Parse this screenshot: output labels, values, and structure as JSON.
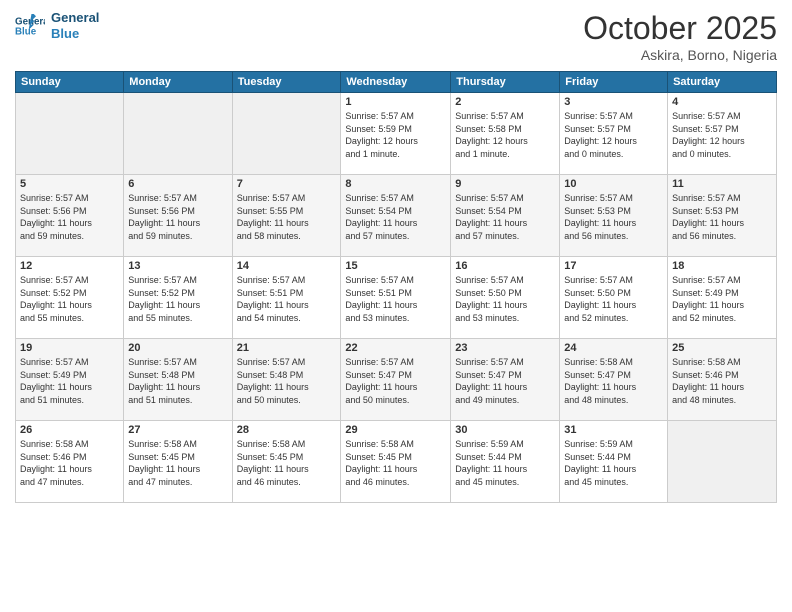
{
  "logo": {
    "line1": "General",
    "line2": "Blue"
  },
  "title": "October 2025",
  "location": "Askira, Borno, Nigeria",
  "days_of_week": [
    "Sunday",
    "Monday",
    "Tuesday",
    "Wednesday",
    "Thursday",
    "Friday",
    "Saturday"
  ],
  "weeks": [
    [
      {
        "day": "",
        "info": ""
      },
      {
        "day": "",
        "info": ""
      },
      {
        "day": "",
        "info": ""
      },
      {
        "day": "1",
        "info": "Sunrise: 5:57 AM\nSunset: 5:59 PM\nDaylight: 12 hours\nand 1 minute."
      },
      {
        "day": "2",
        "info": "Sunrise: 5:57 AM\nSunset: 5:58 PM\nDaylight: 12 hours\nand 1 minute."
      },
      {
        "day": "3",
        "info": "Sunrise: 5:57 AM\nSunset: 5:57 PM\nDaylight: 12 hours\nand 0 minutes."
      },
      {
        "day": "4",
        "info": "Sunrise: 5:57 AM\nSunset: 5:57 PM\nDaylight: 12 hours\nand 0 minutes."
      }
    ],
    [
      {
        "day": "5",
        "info": "Sunrise: 5:57 AM\nSunset: 5:56 PM\nDaylight: 11 hours\nand 59 minutes."
      },
      {
        "day": "6",
        "info": "Sunrise: 5:57 AM\nSunset: 5:56 PM\nDaylight: 11 hours\nand 59 minutes."
      },
      {
        "day": "7",
        "info": "Sunrise: 5:57 AM\nSunset: 5:55 PM\nDaylight: 11 hours\nand 58 minutes."
      },
      {
        "day": "8",
        "info": "Sunrise: 5:57 AM\nSunset: 5:54 PM\nDaylight: 11 hours\nand 57 minutes."
      },
      {
        "day": "9",
        "info": "Sunrise: 5:57 AM\nSunset: 5:54 PM\nDaylight: 11 hours\nand 57 minutes."
      },
      {
        "day": "10",
        "info": "Sunrise: 5:57 AM\nSunset: 5:53 PM\nDaylight: 11 hours\nand 56 minutes."
      },
      {
        "day": "11",
        "info": "Sunrise: 5:57 AM\nSunset: 5:53 PM\nDaylight: 11 hours\nand 56 minutes."
      }
    ],
    [
      {
        "day": "12",
        "info": "Sunrise: 5:57 AM\nSunset: 5:52 PM\nDaylight: 11 hours\nand 55 minutes."
      },
      {
        "day": "13",
        "info": "Sunrise: 5:57 AM\nSunset: 5:52 PM\nDaylight: 11 hours\nand 55 minutes."
      },
      {
        "day": "14",
        "info": "Sunrise: 5:57 AM\nSunset: 5:51 PM\nDaylight: 11 hours\nand 54 minutes."
      },
      {
        "day": "15",
        "info": "Sunrise: 5:57 AM\nSunset: 5:51 PM\nDaylight: 11 hours\nand 53 minutes."
      },
      {
        "day": "16",
        "info": "Sunrise: 5:57 AM\nSunset: 5:50 PM\nDaylight: 11 hours\nand 53 minutes."
      },
      {
        "day": "17",
        "info": "Sunrise: 5:57 AM\nSunset: 5:50 PM\nDaylight: 11 hours\nand 52 minutes."
      },
      {
        "day": "18",
        "info": "Sunrise: 5:57 AM\nSunset: 5:49 PM\nDaylight: 11 hours\nand 52 minutes."
      }
    ],
    [
      {
        "day": "19",
        "info": "Sunrise: 5:57 AM\nSunset: 5:49 PM\nDaylight: 11 hours\nand 51 minutes."
      },
      {
        "day": "20",
        "info": "Sunrise: 5:57 AM\nSunset: 5:48 PM\nDaylight: 11 hours\nand 51 minutes."
      },
      {
        "day": "21",
        "info": "Sunrise: 5:57 AM\nSunset: 5:48 PM\nDaylight: 11 hours\nand 50 minutes."
      },
      {
        "day": "22",
        "info": "Sunrise: 5:57 AM\nSunset: 5:47 PM\nDaylight: 11 hours\nand 50 minutes."
      },
      {
        "day": "23",
        "info": "Sunrise: 5:57 AM\nSunset: 5:47 PM\nDaylight: 11 hours\nand 49 minutes."
      },
      {
        "day": "24",
        "info": "Sunrise: 5:58 AM\nSunset: 5:47 PM\nDaylight: 11 hours\nand 48 minutes."
      },
      {
        "day": "25",
        "info": "Sunrise: 5:58 AM\nSunset: 5:46 PM\nDaylight: 11 hours\nand 48 minutes."
      }
    ],
    [
      {
        "day": "26",
        "info": "Sunrise: 5:58 AM\nSunset: 5:46 PM\nDaylight: 11 hours\nand 47 minutes."
      },
      {
        "day": "27",
        "info": "Sunrise: 5:58 AM\nSunset: 5:45 PM\nDaylight: 11 hours\nand 47 minutes."
      },
      {
        "day": "28",
        "info": "Sunrise: 5:58 AM\nSunset: 5:45 PM\nDaylight: 11 hours\nand 46 minutes."
      },
      {
        "day": "29",
        "info": "Sunrise: 5:58 AM\nSunset: 5:45 PM\nDaylight: 11 hours\nand 46 minutes."
      },
      {
        "day": "30",
        "info": "Sunrise: 5:59 AM\nSunset: 5:44 PM\nDaylight: 11 hours\nand 45 minutes."
      },
      {
        "day": "31",
        "info": "Sunrise: 5:59 AM\nSunset: 5:44 PM\nDaylight: 11 hours\nand 45 minutes."
      },
      {
        "day": "",
        "info": ""
      }
    ]
  ]
}
